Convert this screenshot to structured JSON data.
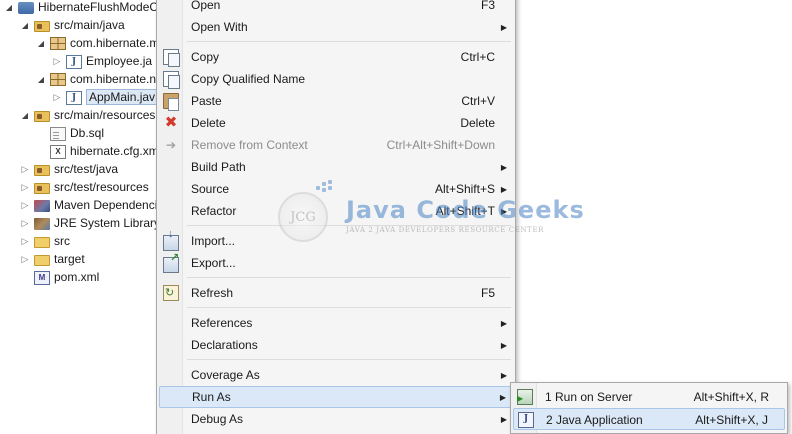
{
  "tree": {
    "items": [
      {
        "label": "HibernateFlushModeC",
        "icon": "project-icon",
        "twisty": "expanded",
        "indent": 0
      },
      {
        "label": "src/main/java",
        "icon": "source-folder-icon",
        "twisty": "expanded",
        "indent": 1
      },
      {
        "label": "com.hibernate.m",
        "icon": "package-icon",
        "twisty": "expanded",
        "indent": 2
      },
      {
        "label": "Employee.ja",
        "icon": "java-file-icon",
        "twisty": "collapsed",
        "indent": 3
      },
      {
        "label": "com.hibernate.n",
        "icon": "package-icon",
        "twisty": "expanded",
        "indent": 2
      },
      {
        "label": "AppMain.jav",
        "icon": "java-file-icon",
        "twisty": "collapsed",
        "indent": 3,
        "selected": true
      },
      {
        "label": "src/main/resources",
        "icon": "source-folder-icon",
        "twisty": "expanded",
        "indent": 1
      },
      {
        "label": "Db.sql",
        "icon": "file-icon",
        "twisty": "none",
        "indent": 2
      },
      {
        "label": "hibernate.cfg.xm",
        "icon": "xml-file-icon",
        "twisty": "none",
        "indent": 2
      },
      {
        "label": "src/test/java",
        "icon": "source-folder-icon",
        "twisty": "collapsed",
        "indent": 1
      },
      {
        "label": "src/test/resources",
        "icon": "source-folder-icon",
        "twisty": "collapsed",
        "indent": 1
      },
      {
        "label": "Maven Dependencie",
        "icon": "maven-library-icon",
        "twisty": "collapsed",
        "indent": 1
      },
      {
        "label": "JRE System Library",
        "icon": "jre-library-icon",
        "twisty": "collapsed",
        "indent": 1
      },
      {
        "label": "src",
        "icon": "folder-icon",
        "twisty": "collapsed",
        "indent": 1
      },
      {
        "label": "target",
        "icon": "folder-icon",
        "twisty": "collapsed",
        "indent": 1
      },
      {
        "label": "pom.xml",
        "icon": "pom-file-icon",
        "twisty": "none",
        "indent": 1
      }
    ]
  },
  "context_menu": {
    "items": [
      {
        "label": "Open",
        "shortcut": "F3"
      },
      {
        "label": "Open With",
        "submenu": true
      },
      {
        "separator": true
      },
      {
        "label": "Copy",
        "shortcut": "Ctrl+C",
        "icon": "copy-icon"
      },
      {
        "label": "Copy Qualified Name",
        "icon": "copy-qualified-icon"
      },
      {
        "label": "Paste",
        "shortcut": "Ctrl+V",
        "icon": "paste-icon"
      },
      {
        "label": "Delete",
        "shortcut": "Delete",
        "icon": "delete-icon"
      },
      {
        "label": "Remove from Context",
        "shortcut": "Ctrl+Alt+Shift+Down",
        "icon": "remove-context-icon",
        "disabled": true
      },
      {
        "label": "Build Path",
        "submenu": true
      },
      {
        "label": "Source",
        "shortcut": "Alt+Shift+S",
        "submenu": true
      },
      {
        "label": "Refactor",
        "shortcut": "Alt+Shift+T",
        "submenu": true
      },
      {
        "separator": true
      },
      {
        "label": "Import...",
        "icon": "import-icon"
      },
      {
        "label": "Export...",
        "icon": "export-icon"
      },
      {
        "separator": true
      },
      {
        "label": "Refresh",
        "shortcut": "F5",
        "icon": "refresh-icon"
      },
      {
        "separator": true
      },
      {
        "label": "References",
        "submenu": true
      },
      {
        "label": "Declarations",
        "submenu": true
      },
      {
        "separator": true
      },
      {
        "label": "Coverage As",
        "submenu": true
      },
      {
        "label": "Run As",
        "submenu": true,
        "hover": true
      },
      {
        "label": "Debug As",
        "submenu": true
      }
    ]
  },
  "run_as_submenu": {
    "items": [
      {
        "label": "1 Run on Server",
        "shortcut": "Alt+Shift+X, R",
        "icon": "run-on-server-icon"
      },
      {
        "label": "2 Java Application",
        "shortcut": "Alt+Shift+X, J",
        "icon": "java-application-icon",
        "hover": true
      }
    ]
  },
  "watermark": {
    "circle_text": "JCG",
    "title": "Java Code Geeks",
    "tagline": "JAVA 2 JAVA DEVELOPERS RESOURCE CENTER"
  },
  "colors": {
    "hover_bg": "#dbe8f7",
    "hover_border": "#a9c5e8",
    "menu_bg": "#f5f5f5",
    "disabled_text": "#8c8c8c",
    "watermark_blue": "#4a83c4"
  }
}
